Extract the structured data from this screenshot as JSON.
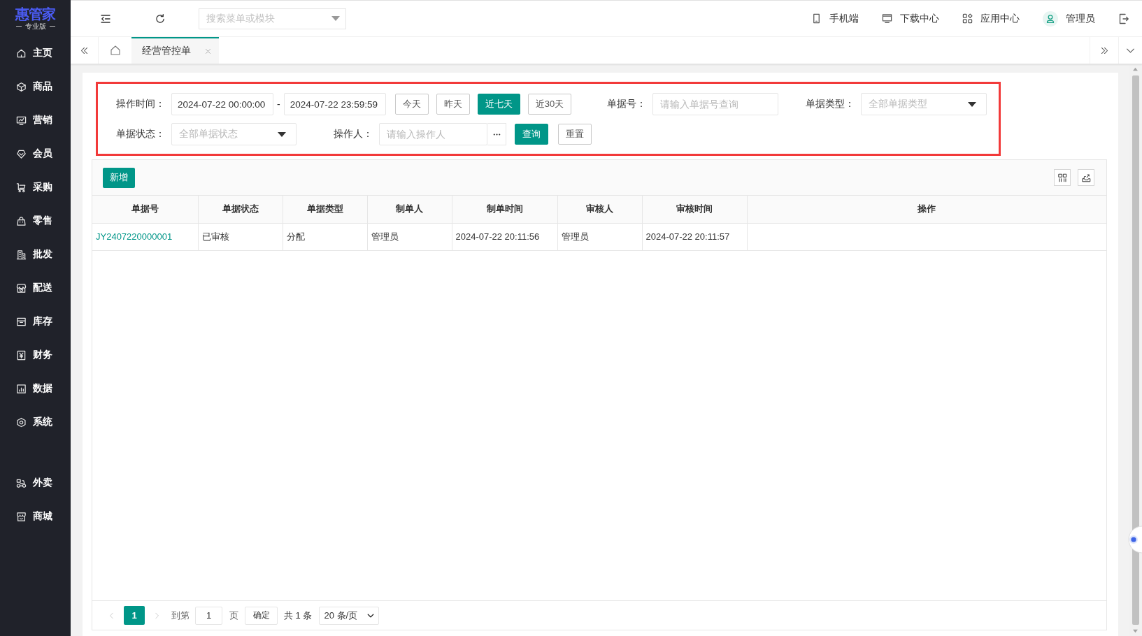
{
  "logo": {
    "title": "惠管家",
    "subtitle": "专业版"
  },
  "sidebar": {
    "items": [
      "主页",
      "商品",
      "营销",
      "会员",
      "采购",
      "零售",
      "批发",
      "配送",
      "库存",
      "财务",
      "数据",
      "系统"
    ],
    "extra_items": [
      "外卖",
      "商城"
    ]
  },
  "header": {
    "search": {
      "placeholder": "搜索菜单或模块"
    },
    "links": [
      "手机端",
      "下载中心",
      "应用中心"
    ],
    "user": "管理员"
  },
  "tabs": [
    {
      "label": "经营管控单",
      "selected": true
    }
  ],
  "filter": {
    "time": {
      "label": "操作时间：",
      "start": "2024-07-22 00:00:00",
      "separator": "-",
      "end": "2024-07-22 23:59:59"
    },
    "quick_ranges": [
      {
        "label": "今天",
        "selected": false
      },
      {
        "label": "昨天",
        "selected": false
      },
      {
        "label": "近七天",
        "selected": true
      },
      {
        "label": "近30天",
        "selected": false
      }
    ],
    "order_no": {
      "label": "单据号：",
      "placeholder": "请输入单据号查询"
    },
    "order_type": {
      "label": "单据类型：",
      "placeholder": "全部单据类型"
    },
    "status": {
      "label": "单据状态：",
      "placeholder": "全部单据状态"
    },
    "operator": {
      "label": "操作人：",
      "placeholder": "请输入操作人"
    },
    "buttons": {
      "search": "查询",
      "reset": "重置"
    }
  },
  "grid": {
    "add_button": "新增",
    "columns": [
      "单据号",
      "单据状态",
      "单据类型",
      "制单人",
      "制单时间",
      "审核人",
      "审核时间",
      "操作"
    ],
    "rows": [
      [
        "JY2407220000001",
        "已审核",
        "分配",
        "管理员",
        "2024-07-22 20:11:56",
        "管理员",
        "2024-07-22 20:11:57"
      ]
    ]
  },
  "pagination": {
    "pages": [
      {
        "label": "1",
        "selected": true
      }
    ],
    "goto_label": "到第",
    "goto_value": "1",
    "page_unit": "页",
    "confirm": "确定",
    "total": "共 1 条",
    "page_size": "20 条/页"
  }
}
